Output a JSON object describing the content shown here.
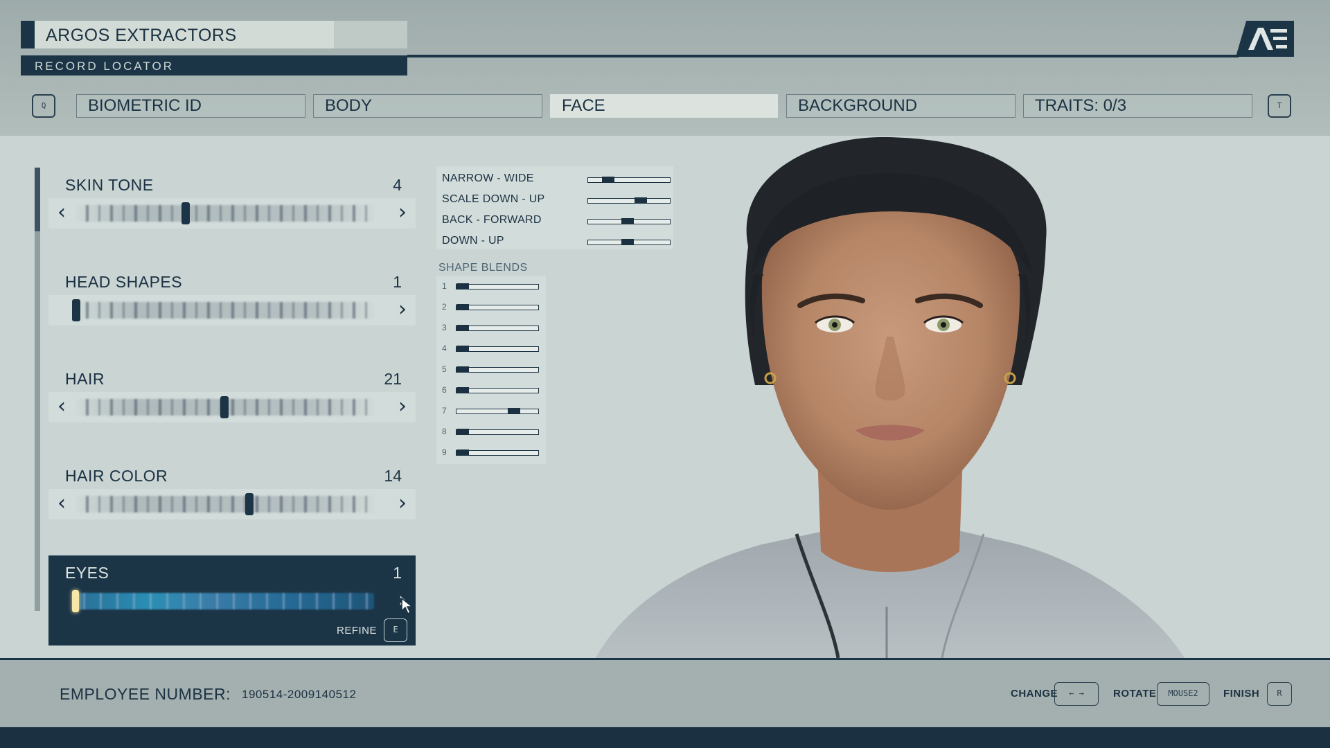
{
  "header": {
    "company_name": "ARGOS EXTRACTORS",
    "record_label": "RECORD LOCATOR",
    "logo_icon": "constellation-logo-icon",
    "prev_key": "Q",
    "next_key": "T",
    "tabs": [
      {
        "label": "BIOMETRIC ID",
        "active": false
      },
      {
        "label": "BODY",
        "active": false
      },
      {
        "label": "FACE",
        "active": true
      },
      {
        "label": "BACKGROUND",
        "active": false
      },
      {
        "label": "TRAITS: 0/3",
        "active": false
      }
    ]
  },
  "features": [
    {
      "name": "SKIN TONE",
      "value": "4",
      "position": 0.36
    },
    {
      "name": "HEAD SHAPES",
      "value": "1",
      "position": 0.0
    },
    {
      "name": "HAIR",
      "value": "21",
      "position": 0.49
    },
    {
      "name": "HAIR COLOR",
      "value": "14",
      "position": 0.5
    },
    {
      "name": "EYES",
      "value": "1",
      "position": 0.0,
      "selected": true,
      "refine_label": "REFINE",
      "refine_key": "E"
    }
  ],
  "transform": [
    {
      "label": "NARROW - WIDE",
      "value": 0.2
    },
    {
      "label": "SCALE DOWN - UP",
      "value": 0.68
    },
    {
      "label": "BACK - FORWARD",
      "value": 0.48
    },
    {
      "label": "DOWN - UP",
      "value": 0.48
    }
  ],
  "shape_blends": {
    "title": "SHAPE BLENDS",
    "items": [
      {
        "num": "1",
        "value": 0.0
      },
      {
        "num": "2",
        "value": 0.0
      },
      {
        "num": "3",
        "value": 0.0
      },
      {
        "num": "4",
        "value": 0.0
      },
      {
        "num": "5",
        "value": 0.0
      },
      {
        "num": "6",
        "value": 0.0
      },
      {
        "num": "7",
        "value": 0.75
      },
      {
        "num": "8",
        "value": 0.0
      },
      {
        "num": "9",
        "value": 0.0
      }
    ]
  },
  "footer": {
    "employee_label": "EMPLOYEE NUMBER:",
    "employee_number": "190514-2009140512",
    "change_label": "CHANGE",
    "change_key": "← →",
    "rotate_label": "ROTATE",
    "rotate_key": "MOUSE2",
    "finish_label": "FINISH",
    "finish_key": "R"
  },
  "colors": {
    "navy": "#1b3547",
    "panel": "#c9d4d3",
    "eyes_accent": "#2a8fb4"
  }
}
